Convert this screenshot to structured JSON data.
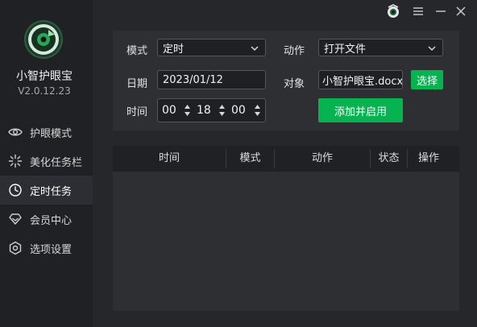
{
  "app": {
    "name": "小智护眼宝",
    "version": "V2.0.12.23"
  },
  "colors": {
    "accent": "#07b250",
    "sidebar": "#202124",
    "panel": "#2e2f33"
  },
  "sidebar": {
    "items": [
      {
        "label": "护眼模式",
        "icon": "eye-icon"
      },
      {
        "label": "美化任务栏",
        "icon": "sparkle-icon"
      },
      {
        "label": "定时任务",
        "icon": "clock-icon",
        "active": true
      },
      {
        "label": "会员中心",
        "icon": "diamond-icon"
      },
      {
        "label": "选项设置",
        "icon": "gear-icon"
      }
    ]
  },
  "window_controls": [
    "avatar-icon",
    "menu-icon",
    "minimize-icon",
    "close-icon"
  ],
  "form": {
    "mode_label": "模式",
    "mode_value": "定时",
    "action_label": "动作",
    "action_value": "打开文件",
    "date_label": "日期",
    "date_value": "2023/01/12",
    "target_label": "对象",
    "target_value": "小智护眼宝.docx",
    "choose_label": "选择",
    "time_label": "时间",
    "time_hour": "00",
    "time_minute": "18",
    "time_second": "00",
    "add_label": "添加并启用"
  },
  "table": {
    "columns": [
      "时间",
      "模式",
      "动作",
      "状态",
      "操作"
    ],
    "rows": []
  }
}
